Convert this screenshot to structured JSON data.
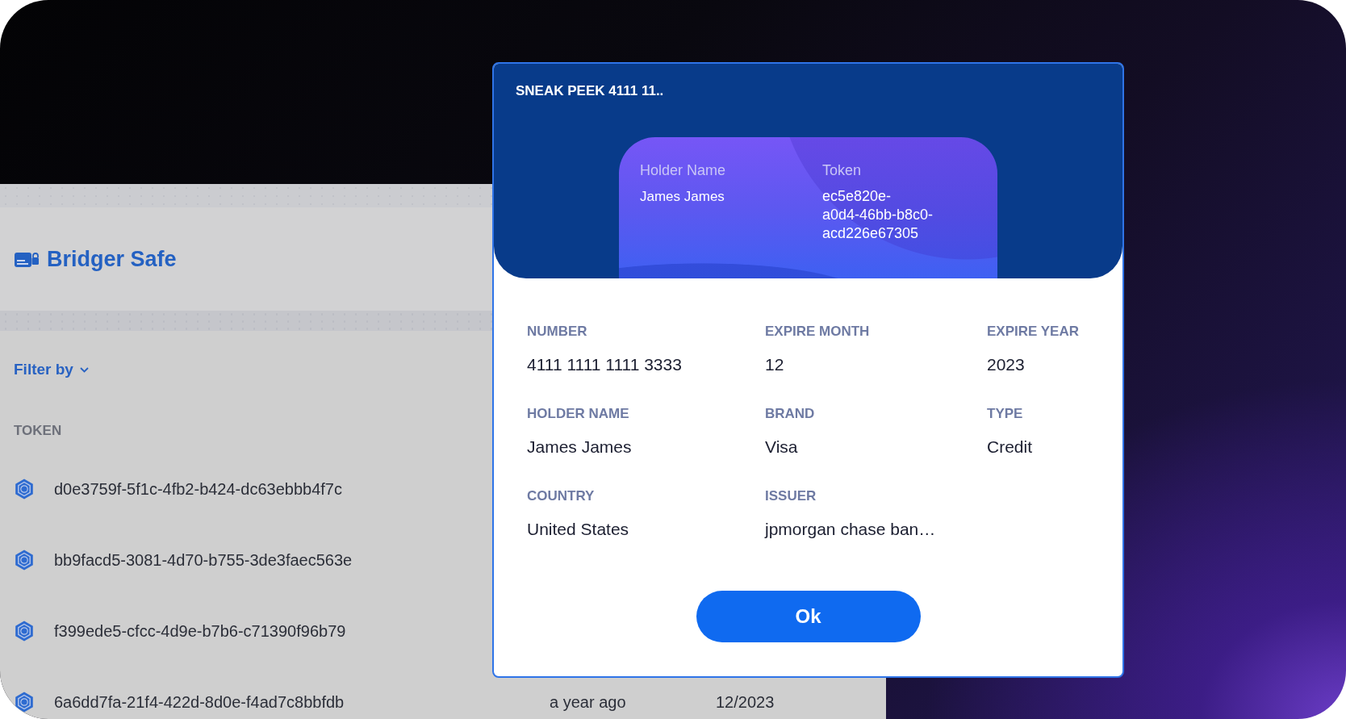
{
  "app": {
    "title": "Bridger Safe",
    "filter": {
      "label": "Filter by"
    },
    "table": {
      "columns": [
        "TOKEN"
      ],
      "rows": [
        {
          "cells": [
            "d0e3759f-5f1c-4fb2-b424-dc63ebbb4f7c"
          ]
        },
        {
          "cells": [
            "bb9facd5-3081-4d70-b755-3de3faec563e"
          ]
        },
        {
          "cells": [
            "f399ede5-cfcc-4d9e-b7b6-c71390f96b79"
          ]
        },
        {
          "cells": [
            "6a6dd7fa-21f4-422d-8d0e-f4ad7c8bbfdb",
            "a year ago",
            "12/2023"
          ]
        }
      ]
    }
  },
  "dialog": {
    "title": "SNEAK PEEK 4111 11..",
    "card": {
      "fields": [
        {
          "label": "Holder Name",
          "value": "James James"
        },
        {
          "label": "Token",
          "value": "ec5e820e-a0d4-46bb-b8c0-acd226e67305"
        }
      ]
    },
    "fields": [
      {
        "label": "NUMBER",
        "value": "4111 1111 1111 3333"
      },
      {
        "label": "EXPIRE MONTH",
        "value": "12"
      },
      {
        "label": "EXPIRE YEAR",
        "value": "2023"
      },
      {
        "label": "HOLDER NAME",
        "value": "James James"
      },
      {
        "label": "BRAND",
        "value": "Visa"
      },
      {
        "label": "TYPE",
        "value": "Credit"
      },
      {
        "label": "COUNTRY",
        "value": "United States"
      },
      {
        "label": "ISSUER",
        "value": "jpmorgan chase ban…"
      }
    ],
    "buttons": [
      "Ok"
    ]
  }
}
